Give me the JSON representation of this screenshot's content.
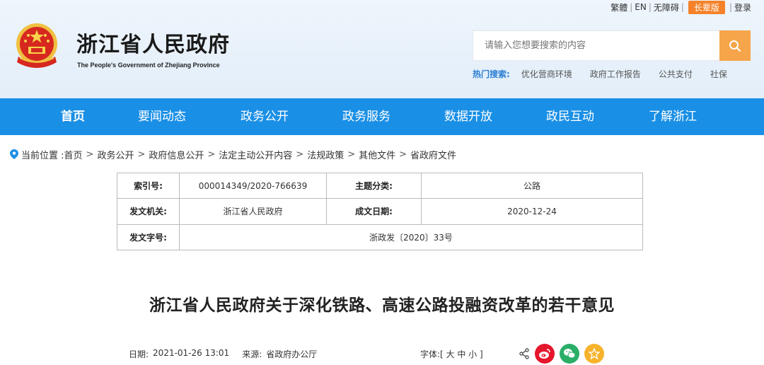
{
  "top_links": {
    "traditional": "繁體",
    "english": "EN",
    "accessibility": "无障碍",
    "elder_mode": "长辈版",
    "login": "登录"
  },
  "site": {
    "title": "浙江省人民政府",
    "subtitle": "The People's Government of Zhejiang Province"
  },
  "search": {
    "placeholder": "请输入您想要搜索的内容",
    "hot_label": "热门搜索:",
    "hot_keywords": [
      "优化营商环境",
      "政府工作报告",
      "公共支付",
      "社保"
    ]
  },
  "nav": [
    {
      "label": "首页",
      "active": true
    },
    {
      "label": "要闻动态",
      "active": false
    },
    {
      "label": "政务公开",
      "active": false
    },
    {
      "label": "政务服务",
      "active": false
    },
    {
      "label": "数据开放",
      "active": false
    },
    {
      "label": "政民互动",
      "active": false
    },
    {
      "label": "了解浙江",
      "active": false
    }
  ],
  "breadcrumb": {
    "prefix": "当前位置 :",
    "items": [
      "首页",
      "政务公开",
      "政府信息公开",
      "法定主动公开内容",
      "法规政策",
      "其他文件",
      "省政府文件"
    ]
  },
  "info": {
    "index_label": "索引号:",
    "index_value": "000014349/2020-766639",
    "topic_label": "主题分类:",
    "topic_value": "公路",
    "issuer_label": "发文机关:",
    "issuer_value": "浙江省人民政府",
    "date_label": "成文日期:",
    "date_value": "2020-12-24",
    "docno_label": "发文字号:",
    "docno_value": "浙政发〔2020〕33号"
  },
  "article": {
    "title": "浙江省人民政府关于深化铁路、高速公路投融资改革的若干意见",
    "date_label": "日期:",
    "date_value": "2021-01-26 13:01",
    "source_label": "来源:",
    "source_value": "省政府办公厅",
    "font_size_label": "字体:[ 大 中 小 ]"
  },
  "colors": {
    "nav_bg": "#1a8fe6",
    "search_btn": "#f6a54a",
    "elder_btn": "#f5822a",
    "weibo": "#e6162d",
    "wechat": "#2aae67",
    "favorite": "#f6b32b"
  },
  "icons": {
    "search": "search-icon",
    "location": "location-pin-icon",
    "share": "share-icon",
    "weibo": "weibo-icon",
    "wechat": "wechat-icon",
    "favorite": "star-icon"
  }
}
